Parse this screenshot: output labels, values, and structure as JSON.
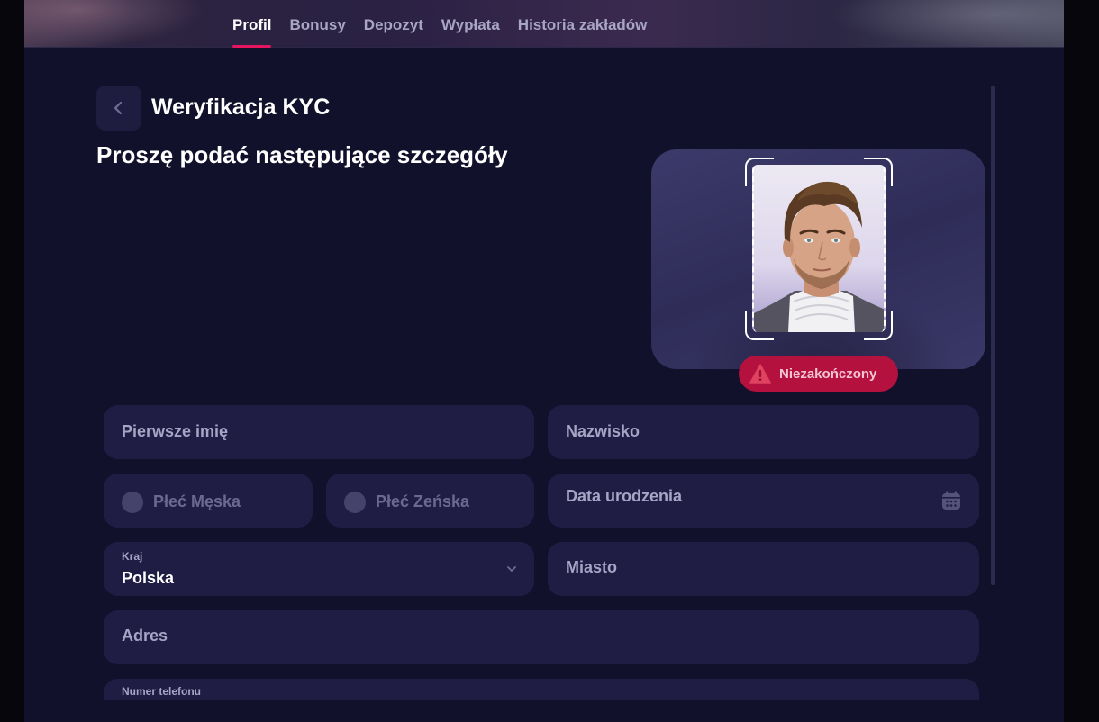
{
  "nav": {
    "tabs": [
      {
        "label": "Profil",
        "active": true
      },
      {
        "label": "Bonusy",
        "active": false
      },
      {
        "label": "Depozyt",
        "active": false
      },
      {
        "label": "Wypłata",
        "active": false
      },
      {
        "label": "Historia zakładów",
        "active": false
      }
    ]
  },
  "header": {
    "title": "Weryfikacja KYC",
    "back_icon": "chevron-left-icon"
  },
  "form": {
    "subtitle": "Proszę podać następujące szczegóły",
    "first_name_placeholder": "Pierwsze imię",
    "last_name_placeholder": "Nazwisko",
    "gender_male": "Płeć Męska",
    "gender_female": "Płeć Zeńska",
    "birthdate_placeholder": "Data urodzenia",
    "birthdate_icon": "calendar-icon",
    "country_label": "Kraj",
    "country_value": "Polska",
    "country_icon": "chevron-down-icon",
    "city_placeholder": "Miasto",
    "address_placeholder": "Adres",
    "phone_label": "Numer telefonu"
  },
  "verification": {
    "status": "Niezakończony",
    "status_icon": "warning-icon",
    "status_color": "#b5113f"
  },
  "colors": {
    "accent": "#e5155f",
    "background": "#12112c",
    "field": "#1f1d44"
  }
}
